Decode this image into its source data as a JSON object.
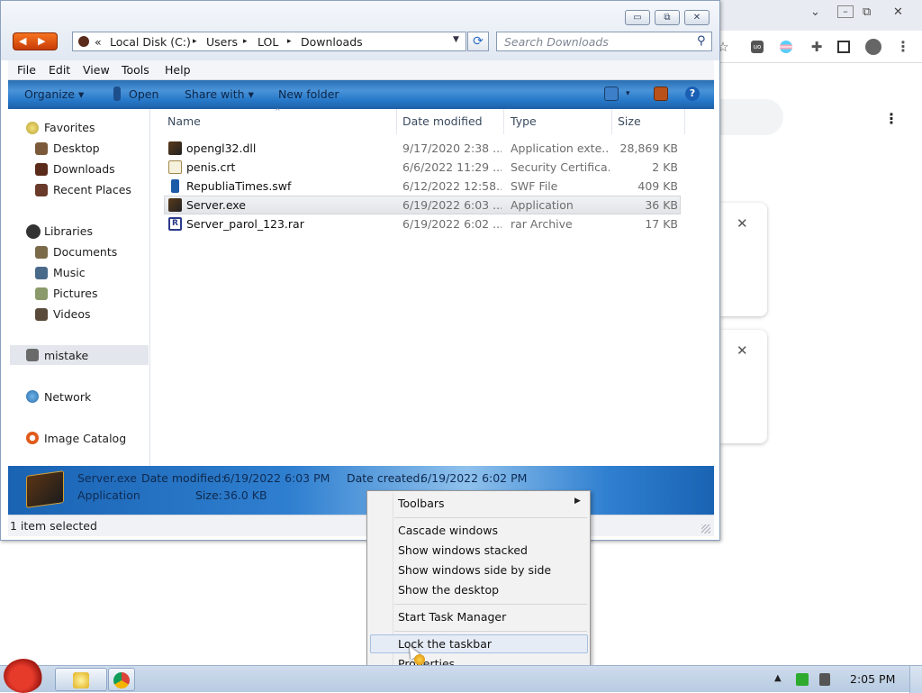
{
  "explorer": {
    "window_buttons": {
      "minimize": "▭",
      "maximize": "⧉",
      "close": "✕"
    },
    "address": {
      "overflow": "«",
      "crumbs": [
        "Local Disk (C:)",
        "Users",
        "LOL",
        "Downloads"
      ],
      "separator": "▸"
    },
    "search_placeholder": "Search Downloads",
    "menu": [
      "File",
      "Edit",
      "View",
      "Tools",
      "Help"
    ],
    "toolbar": {
      "organize": "Organize",
      "open": "Open",
      "share_with": "Share with",
      "new_folder": "New folder",
      "dropdown": "▾"
    },
    "sidebar": {
      "favorites": "Favorites",
      "desktop": "Desktop",
      "downloads": "Downloads",
      "recent_places": "Recent Places",
      "libraries": "Libraries",
      "documents": "Documents",
      "music": "Music",
      "pictures": "Pictures",
      "videos": "Videos",
      "mistake": "mistake",
      "network": "Network",
      "image_catalog": "Image Catalog"
    },
    "columns": {
      "name": "Name",
      "date_modified": "Date modified",
      "type": "Type",
      "size": "Size"
    },
    "files": [
      {
        "name": "opengl32.dll",
        "date": "9/17/2020 2:38 ...",
        "type": "Application exte...",
        "size": "28,869 KB",
        "selected": false
      },
      {
        "name": "penis.crt",
        "date": "6/6/2022 11:29 ...",
        "type": "Security Certifica...",
        "size": "2 KB",
        "selected": false
      },
      {
        "name": "RepubliaTimes.swf",
        "date": "6/12/2022 12:58...",
        "type": "SWF File",
        "size": "409 KB",
        "selected": false
      },
      {
        "name": "Server.exe",
        "date": "6/19/2022 6:03 ...",
        "type": "Application",
        "size": "36 KB",
        "selected": true
      },
      {
        "name": "Server_parol_123.rar",
        "date": "6/19/2022 6:02 ...",
        "type": "rar Archive",
        "size": "17 KB",
        "selected": false
      }
    ],
    "details": {
      "filename": "Server.exe",
      "filetype": "Application",
      "date_modified_label": "Date modified:",
      "date_modified": "6/19/2022 6:03 PM",
      "date_created_label": "Date created:",
      "date_created": "6/19/2022 6:02 PM",
      "size_label": "Size:",
      "size": "36.0 KB"
    },
    "status": "1 item selected"
  },
  "context_menu": {
    "items": [
      "Toolbars",
      "Cascade windows",
      "Show windows stacked",
      "Show windows side by side",
      "Show the desktop",
      "Start Task Manager",
      "Lock the taskbar",
      "Properties"
    ],
    "submenu_arrow": "▶"
  },
  "taskbar": {
    "clock": "2:05 PM",
    "tray_arrow": "▲"
  },
  "browser": {
    "ctl_min": "⌄",
    "ctl_restore": "⧉",
    "ctl_close": "✕",
    "star": "☆",
    "kebab": "⋮",
    "card_close": "✕"
  }
}
